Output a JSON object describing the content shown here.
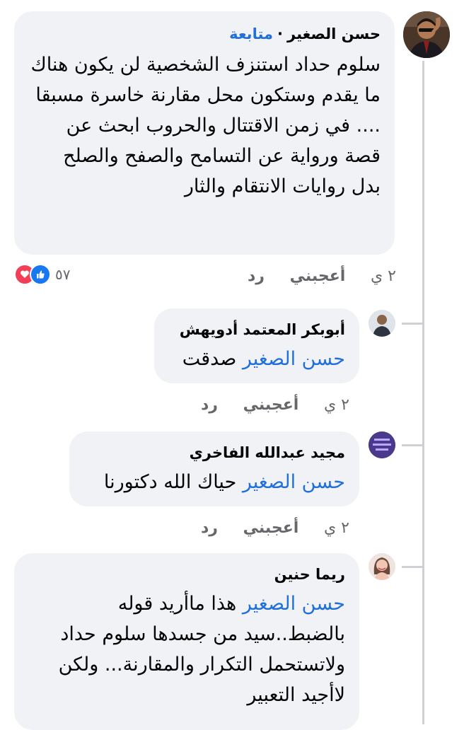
{
  "comments": [
    {
      "author": "حسن الصغير",
      "follow_label": "متابعة",
      "text": "سلوم حداد استنزف  الشخصية لن يكون هناك ما يقدم وستكون محل مقارنة خاسرة مسبقا .... في زمن الاقتتال والحروب ابحث عن قصة ورواية عن التسامح والصفح والصلح  بدل روايات الانتقام والثار",
      "time": "٢ ي",
      "like_label": "أعجبني",
      "reply_label": "رد",
      "reaction_count": "٥٧"
    }
  ],
  "replies": [
    {
      "author": "أبوبكر المعتمد أدويهش",
      "mention": "حسن الصغير",
      "text": "صدقت",
      "time": "٢ ي",
      "like_label": "أعجبني",
      "reply_label": "رد"
    },
    {
      "author": "مجيد عبدالله الفاخري",
      "mention": "حسن الصغير",
      "text": "حياك الله دكتورنا",
      "time": "٢ ي",
      "like_label": "أعجبني",
      "reply_label": "رد"
    },
    {
      "author": "ريما حنين",
      "mention": "حسن الصغير",
      "text": " هذا ماأريد قوله بالضبط..سيد من جسدها سلوم حداد ولاتستحمل التكرار والمقارنة... ولكن لاأجيد التعبير"
    }
  ],
  "colors": {
    "bubble": "#f0f2f5",
    "link": "#216fdb",
    "meta": "#65676b",
    "like": "#1877f2",
    "love": "#f33e58"
  }
}
